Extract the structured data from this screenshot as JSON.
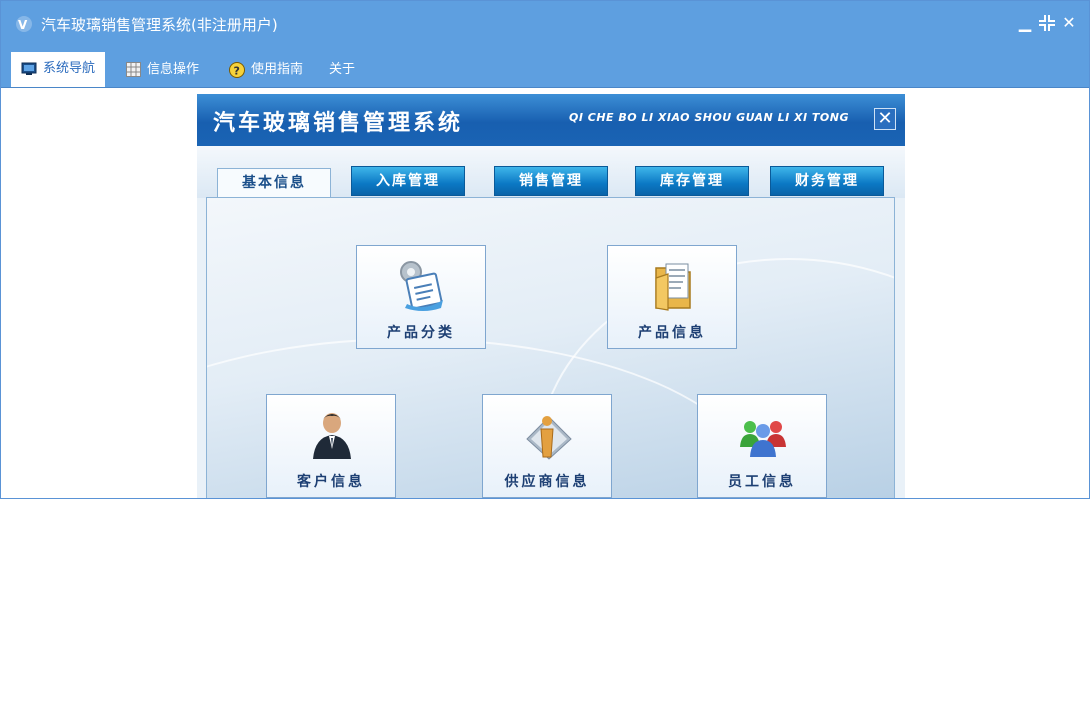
{
  "window": {
    "title": "汽车玻璃销售管理系统(非注册用户)",
    "controls": [
      "minimize-icon",
      "restore-icon",
      "close-icon"
    ]
  },
  "menubar": {
    "items": [
      {
        "label": "系统导航",
        "icon": "monitor-icon",
        "active": true
      },
      {
        "label": "信息操作",
        "icon": "grid-icon",
        "active": false
      },
      {
        "label": "使用指南",
        "icon": "help-icon",
        "active": false
      },
      {
        "label": "关于",
        "icon": "",
        "active": false
      }
    ]
  },
  "app": {
    "title": "汽车玻璃销售管理系统",
    "subtitle": "QI CHE BO LI XIAO SHOU GUAN LI XI TONG",
    "close_label": "✕",
    "tabs": [
      {
        "label": "基本信息",
        "active": true
      },
      {
        "label": "入库管理",
        "active": false
      },
      {
        "label": "销售管理",
        "active": false
      },
      {
        "label": "库存管理",
        "active": false
      },
      {
        "label": "财务管理",
        "active": false
      }
    ],
    "buttons": [
      {
        "label": "产品分类",
        "icon": "product-category-icon"
      },
      {
        "label": "产品信息",
        "icon": "product-info-folder-icon"
      },
      {
        "label": "客户信息",
        "icon": "customer-person-icon"
      },
      {
        "label": "供应商信息",
        "icon": "supplier-icon"
      },
      {
        "label": "员工信息",
        "icon": "staff-group-icon"
      }
    ]
  },
  "colors": {
    "titlebar": "#5e9fe0",
    "header": "#185fb0",
    "tab": "#0b78c4",
    "label": "#1d3f73"
  }
}
